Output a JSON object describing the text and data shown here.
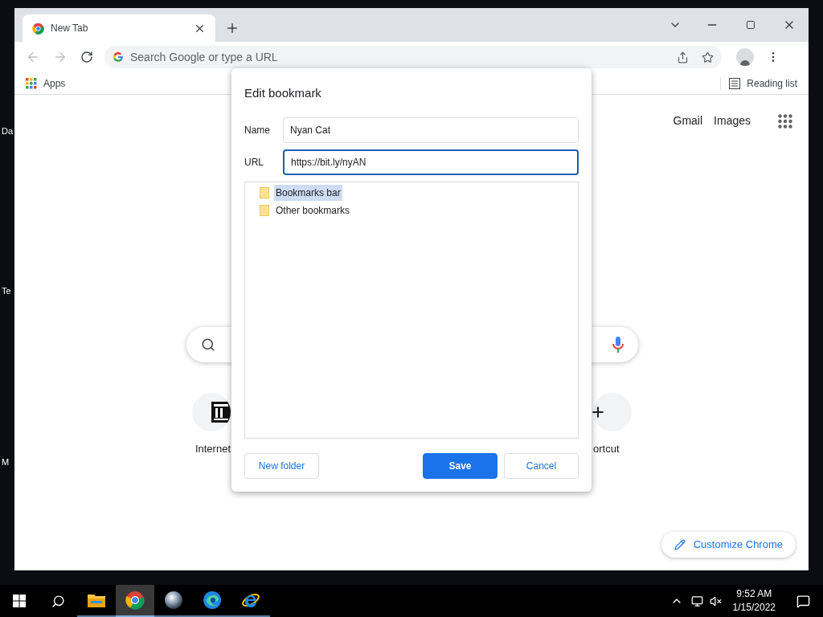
{
  "desktop_icons": [
    {
      "label": "Da"
    },
    {
      "label": "Te"
    },
    {
      "label": "M"
    }
  ],
  "browser": {
    "tabs": [
      {
        "title": "New Tab",
        "selected": true
      }
    ],
    "omnibox": {
      "placeholder": "Search Google or type a URL"
    },
    "bookmarks_bar": {
      "apps": "Apps",
      "reading_list": "Reading list"
    },
    "page": {
      "links": [
        "Gmail",
        "Images"
      ],
      "shortcuts": [
        {
          "kind": "site",
          "label": "Internet"
        },
        {
          "kind": "add",
          "label": "ortcut"
        }
      ],
      "customize": "Customize Chrome"
    }
  },
  "dialog": {
    "title": "Edit bookmark",
    "fields": [
      {
        "label": "Name",
        "value": "Nyan Cat",
        "focused": false
      },
      {
        "label": "URL",
        "value": "https://bit.ly/nyAN",
        "focused": true
      }
    ],
    "folders": [
      {
        "name": "Bookmarks bar",
        "selected": true
      },
      {
        "name": "Other bookmarks",
        "selected": false
      }
    ],
    "buttons": [
      {
        "label": "New folder",
        "kind": "secondary"
      },
      {
        "label": "Save",
        "kind": "primary"
      },
      {
        "label": "Cancel",
        "kind": "secondary"
      }
    ]
  },
  "taskbar": {
    "apps": [
      {
        "kind": "explorer",
        "active": false
      },
      {
        "kind": "chrome",
        "active": true
      },
      {
        "kind": "sphere",
        "active": false
      },
      {
        "kind": "edge",
        "active": false
      },
      {
        "kind": "ie",
        "active": false
      }
    ],
    "time": "9:52 AM",
    "date": "1/15/2022"
  }
}
